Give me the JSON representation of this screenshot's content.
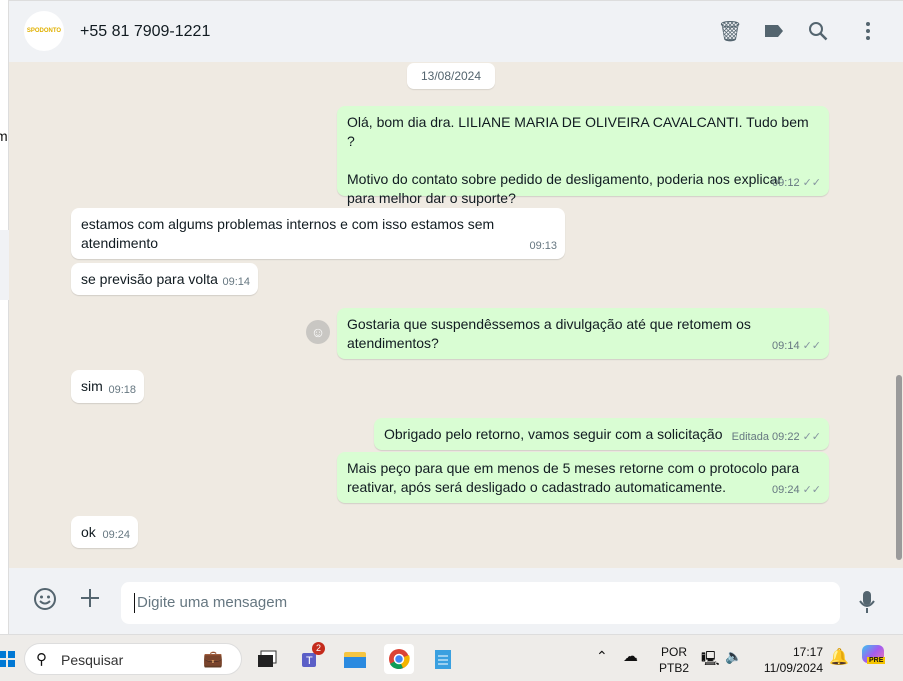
{
  "header": {
    "avatar_text": "SPODONTO",
    "contact": "+55 81 7909-1221"
  },
  "left_partial": "m",
  "date": "13/08/2024",
  "messages": [
    {
      "dir": "out",
      "lines": [
        "Olá, bom dia dra. LILIANE MARIA DE OLIVEIRA CAVALCANTI. Tudo bem ?",
        "",
        "Motivo do contato sobre pedido de desligamento, poderia nos explicar para melhor dar o suporte?"
      ],
      "time": "09:12"
    },
    {
      "dir": "in",
      "text": "estamos com algums problemas internos e com isso estamos sem atendimento",
      "time": "09:13"
    },
    {
      "dir": "in",
      "text": "se previsão para volta",
      "time": "09:14"
    },
    {
      "dir": "out",
      "text": "Gostaria que suspendêssemos a divulgação até que retomem os atendimentos?",
      "time": "09:14"
    },
    {
      "dir": "in",
      "text": "sim",
      "time": "09:18"
    },
    {
      "dir": "out",
      "text": "Obrigado pelo retorno, vamos seguir com a solicitação",
      "edited": "Editada",
      "time": "09:22"
    },
    {
      "dir": "out",
      "text": "Mais peço para que em menos de 5 meses retorne com o protocolo para reativar, após será desligado o cadastrado automaticamente.",
      "time": "09:24"
    },
    {
      "dir": "in",
      "text": "ok",
      "time": "09:24"
    }
  ],
  "composer": {
    "placeholder": "Digite uma mensagem"
  },
  "taskbar": {
    "search": "Pesquisar",
    "teams_badge": "2",
    "lang1": "POR",
    "lang2": "PTB2",
    "time": "17:17",
    "date": "11/09/2024",
    "copilot_badge": "PRE"
  }
}
